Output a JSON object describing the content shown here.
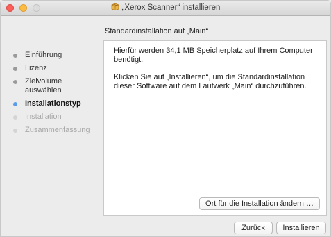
{
  "window": {
    "title": "„Xerox Scanner“ installieren"
  },
  "header": {
    "subtitle": "Standardinstallation auf „Main“"
  },
  "sidebar": {
    "steps": [
      {
        "label": "Einführung",
        "state": "done"
      },
      {
        "label": "Lizenz",
        "state": "done"
      },
      {
        "label": "Zielvolume auswählen",
        "state": "done"
      },
      {
        "label": "Installationstyp",
        "state": "active"
      },
      {
        "label": "Installation",
        "state": "future"
      },
      {
        "label": "Zusammenfassung",
        "state": "future"
      }
    ]
  },
  "content": {
    "paragraph1": "Hierfür werden 34,1 MB Speicherplatz auf Ihrem Computer benötigt.",
    "paragraph2": "Klicken Sie auf „Installieren“, um die Standardinstallation dieser Software auf dem Laufwerk „Main“ durchzuführen.",
    "change_location_label": "Ort für die Installation ändern …"
  },
  "footer": {
    "back_label": "Zurück",
    "install_label": "Installieren"
  },
  "colors": {
    "active_step": "#5c9aea",
    "close": "#fc605b",
    "minimize": "#fdbc40"
  }
}
